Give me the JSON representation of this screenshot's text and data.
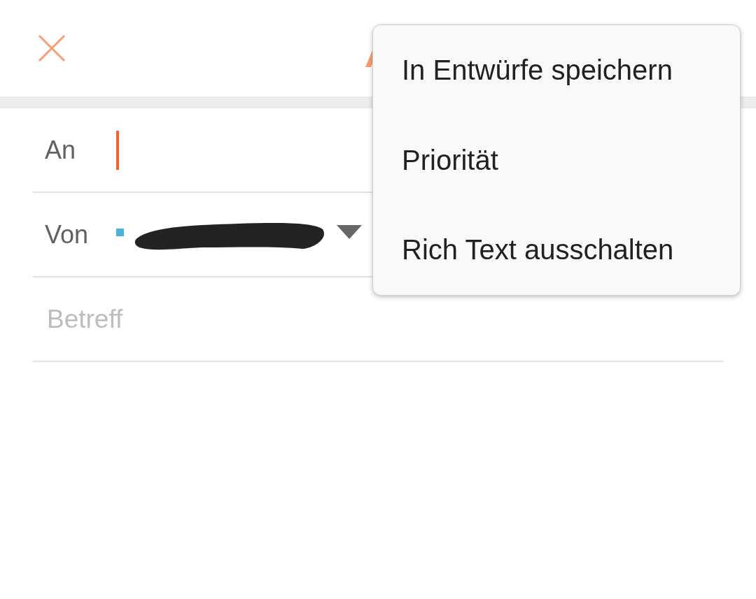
{
  "fields": [
    {
      "kind": "recipient",
      "label": "An",
      "focused": true
    },
    {
      "kind": "sender",
      "label": "Von",
      "color": "#4ab3e0"
    },
    {
      "kind": "subject",
      "placeholder": "Betreff"
    }
  ],
  "menu": {
    "items": [
      {
        "label": "In Entwürfe speichern"
      },
      {
        "label": "Priorität"
      },
      {
        "label": "Rich Text ausschalten"
      }
    ]
  }
}
